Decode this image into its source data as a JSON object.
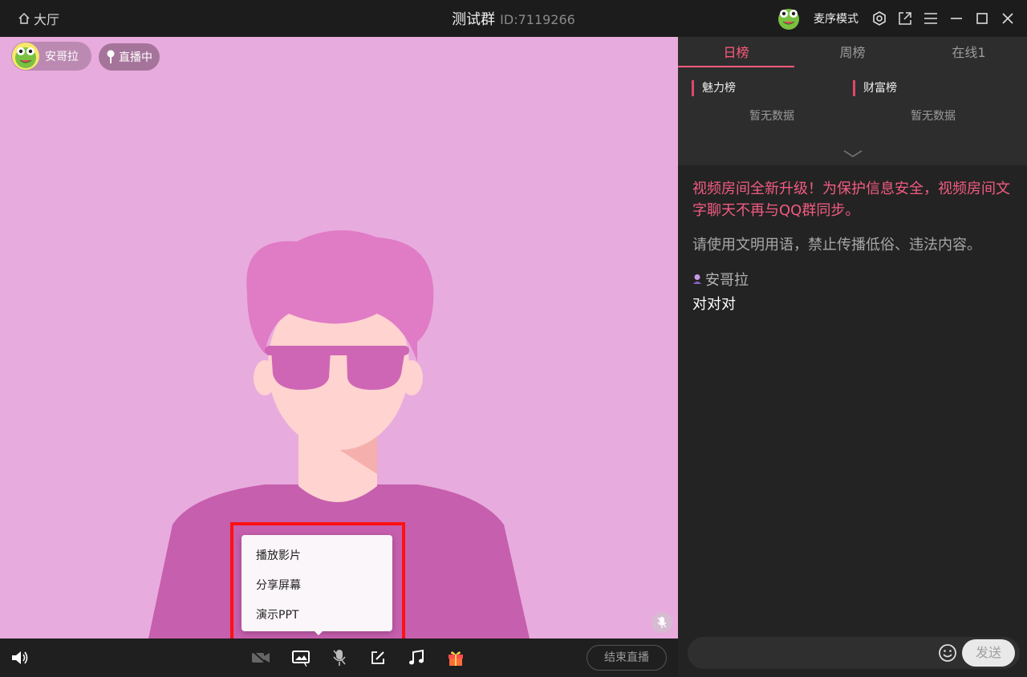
{
  "topbar": {
    "home_label": "大厅",
    "group_name": "测试群",
    "group_id": "ID:7119266",
    "mode_label": "麦序模式"
  },
  "video": {
    "user_name": "安哥拉",
    "live_label": "直播中"
  },
  "popup_menu": {
    "items": [
      "播放影片",
      "分享屏幕",
      "演示PPT"
    ]
  },
  "bottombar": {
    "end_label": "结束直播"
  },
  "panel": {
    "tabs": [
      "日榜",
      "周榜",
      "在线1"
    ],
    "active_tab": "日榜",
    "charm_title": "魅力榜",
    "wealth_title": "财富榜",
    "charm_empty": "暂无数据",
    "wealth_empty": "暂无数据",
    "notice_red": "视频房间全新升级！为保护信息安全，视频房间文字聊天不再与QQ群同步。",
    "notice_gray": "请使用文明用语，禁止传播低俗、违法内容。",
    "chat_user": "安哥拉",
    "chat_message": "对对对",
    "send_label": "发送"
  },
  "colors": {
    "accent": "#ff5c7c",
    "video_bg": "#e8abdd",
    "highlight_box": "#ff1111"
  }
}
